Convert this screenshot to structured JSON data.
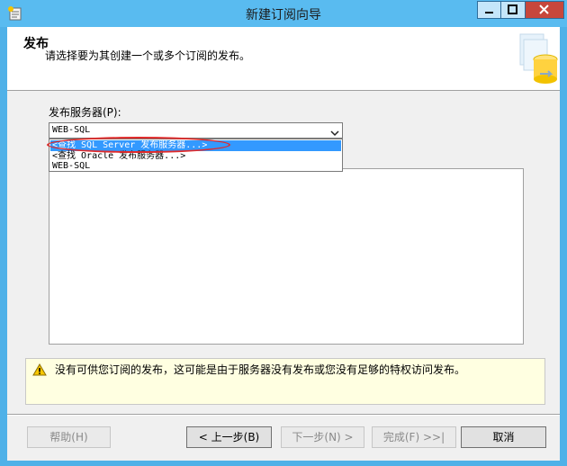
{
  "window": {
    "title": "新建订阅向导"
  },
  "header": {
    "heading": "发布",
    "description": "请选择要为其创建一个或多个订阅的发布。"
  },
  "publisher": {
    "label": "发布服务器(P):",
    "selected_value": "WEB-SQL",
    "dropdown_options": [
      "<查找 SQL Server 发布服务器...>",
      "<查找 Oracle 发布服务器...>",
      "WEB-SQL"
    ]
  },
  "warning": {
    "icon": "warning-icon",
    "text": "没有可供您订阅的发布，这可能是由于服务器没有发布或您没有足够的特权访问发布。"
  },
  "footer": {
    "help_label": "帮助(H)",
    "back_label": "< 上一步(B)",
    "next_label": "下一步(N) >",
    "finish_label": "完成(F) >>|",
    "cancel_label": "取消"
  },
  "colors": {
    "titlebar": "#59bbf0",
    "close_button": "#c7473c",
    "selection": "#3399ff",
    "annotation": "#e02a2a",
    "warning_bg": "#ffffe1"
  }
}
